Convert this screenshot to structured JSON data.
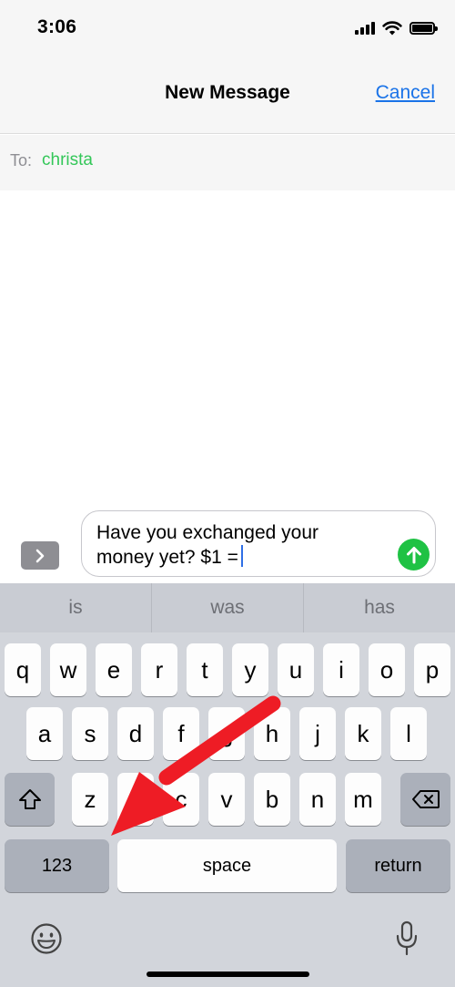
{
  "status_bar": {
    "time": "3:06"
  },
  "nav": {
    "title": "New Message",
    "cancel_label": "Cancel"
  },
  "to_field": {
    "label": "To:",
    "recipient": "christa"
  },
  "compose": {
    "text_line1": "Have you exchanged your",
    "text_line2": "money yet? $1 ="
  },
  "keyboard": {
    "suggestions": [
      "is",
      "was",
      "has"
    ],
    "row1": [
      "q",
      "w",
      "e",
      "r",
      "t",
      "y",
      "u",
      "i",
      "o",
      "p"
    ],
    "row2": [
      "a",
      "s",
      "d",
      "f",
      "g",
      "h",
      "j",
      "k",
      "l"
    ],
    "row3": [
      "z",
      "x",
      "c",
      "v",
      "b",
      "n",
      "m"
    ],
    "numbers_label": "123",
    "space_label": "space",
    "return_label": "return"
  },
  "icons": {
    "expand": "chevron-right-icon",
    "send": "arrow-up-icon",
    "shift": "shift-icon",
    "delete": "backspace-icon",
    "emoji": "emoji-icon",
    "mic": "microphone-icon"
  },
  "colors": {
    "accent_link": "#1a73e8",
    "recipient": "#34c759",
    "send_button": "#1fc244",
    "annotation_arrow": "#ee1c25"
  }
}
